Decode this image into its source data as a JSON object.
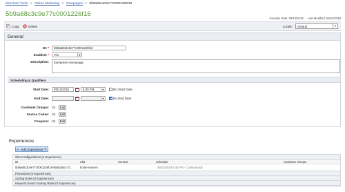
{
  "breadcrumb": {
    "items": [
      "Merchant Tools",
      "Online Marketing",
      "Campaigns"
    ],
    "current": "5b9a68c3c9e77c0001226f16",
    "separator": ">"
  },
  "page": {
    "title": "5b9a68c3c9e77c0001226f16",
    "creation_date": "Creation Date: 09/13/2018",
    "last_modified": "Last Modified: 09/13/2018"
  },
  "toolbar": {
    "copy_label": "Copy",
    "delete_label": "Delete",
    "locale_label": "Locale:",
    "locale_value": "Default"
  },
  "general": {
    "header": "General",
    "id_label": "ID:",
    "id_value": "5b9a68c3c9e77c0001226f16",
    "enabled_label": "Enabled:",
    "enabled_value": "Yes",
    "description_label": "Description:",
    "description_value": "Evergreen Homepage"
  },
  "scheduling": {
    "header": "Scheduling & Qualifiers",
    "start_date_label": "Start Date:",
    "start_date_value": "09/13/2018",
    "start_time_value": "5:30 PM",
    "no_start_date_label": "No Start Date",
    "no_start_date_checked": false,
    "end_date_label": "End Date:",
    "end_date_value": "",
    "end_time_value": "",
    "no_end_date_label": "No End Date",
    "no_end_date_checked": true,
    "customer_groups_label": "Customer Groups:",
    "customer_groups_count": "(0)",
    "source_codes_label": "Source Codes:",
    "source_codes_count": "(0)",
    "coupons_label": "Coupons:",
    "coupons_count": "(0)",
    "edit_label": "Edit"
  },
  "experiences": {
    "title": "Experiences",
    "add_button": "Add Experience",
    "slot_config_header": "Slot Configurations (1 Experience)",
    "columns": [
      "ID",
      "Slot",
      "Context",
      "Schedule",
      "Customer Groups"
    ],
    "rows": [
      {
        "id": "5b9a68c3c9e77c0001226f16-90482a61-27...",
        "slot": "home-main-m",
        "context": "",
        "schedule": "09/13/2018 5:45 PM - Continuously",
        "customer_groups": ""
      }
    ],
    "promotions": "Promotions (0 Experiences)",
    "sorting_rules": "Sorting Rules (0 Experiences)",
    "keyword_rules": "Keyword Search Sorting Rules (0 Experiences)"
  },
  "colors": {
    "title_green": "#5a9a3a",
    "link_blue": "#2a5aa8",
    "required_red": "#cc0000"
  }
}
